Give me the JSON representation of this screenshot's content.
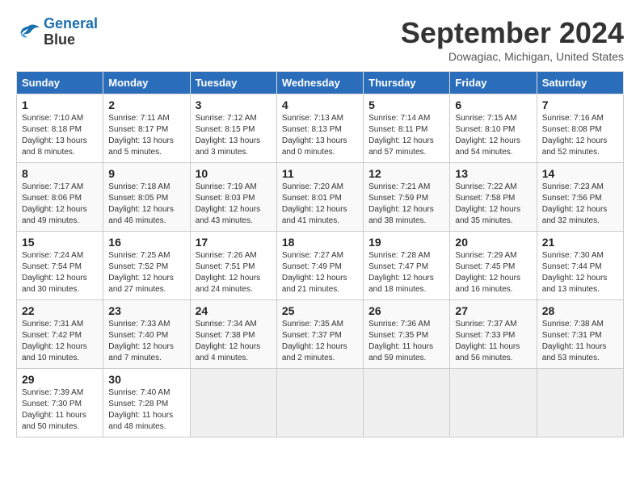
{
  "header": {
    "logo_line1": "General",
    "logo_line2": "Blue",
    "month": "September 2024",
    "location": "Dowagiac, Michigan, United States"
  },
  "days_of_week": [
    "Sunday",
    "Monday",
    "Tuesday",
    "Wednesday",
    "Thursday",
    "Friday",
    "Saturday"
  ],
  "weeks": [
    [
      {
        "day": "1",
        "info": "Sunrise: 7:10 AM\nSunset: 8:18 PM\nDaylight: 13 hours\nand 8 minutes."
      },
      {
        "day": "2",
        "info": "Sunrise: 7:11 AM\nSunset: 8:17 PM\nDaylight: 13 hours\nand 5 minutes."
      },
      {
        "day": "3",
        "info": "Sunrise: 7:12 AM\nSunset: 8:15 PM\nDaylight: 13 hours\nand 3 minutes."
      },
      {
        "day": "4",
        "info": "Sunrise: 7:13 AM\nSunset: 8:13 PM\nDaylight: 13 hours\nand 0 minutes."
      },
      {
        "day": "5",
        "info": "Sunrise: 7:14 AM\nSunset: 8:11 PM\nDaylight: 12 hours\nand 57 minutes."
      },
      {
        "day": "6",
        "info": "Sunrise: 7:15 AM\nSunset: 8:10 PM\nDaylight: 12 hours\nand 54 minutes."
      },
      {
        "day": "7",
        "info": "Sunrise: 7:16 AM\nSunset: 8:08 PM\nDaylight: 12 hours\nand 52 minutes."
      }
    ],
    [
      {
        "day": "8",
        "info": "Sunrise: 7:17 AM\nSunset: 8:06 PM\nDaylight: 12 hours\nand 49 minutes."
      },
      {
        "day": "9",
        "info": "Sunrise: 7:18 AM\nSunset: 8:05 PM\nDaylight: 12 hours\nand 46 minutes."
      },
      {
        "day": "10",
        "info": "Sunrise: 7:19 AM\nSunset: 8:03 PM\nDaylight: 12 hours\nand 43 minutes."
      },
      {
        "day": "11",
        "info": "Sunrise: 7:20 AM\nSunset: 8:01 PM\nDaylight: 12 hours\nand 41 minutes."
      },
      {
        "day": "12",
        "info": "Sunrise: 7:21 AM\nSunset: 7:59 PM\nDaylight: 12 hours\nand 38 minutes."
      },
      {
        "day": "13",
        "info": "Sunrise: 7:22 AM\nSunset: 7:58 PM\nDaylight: 12 hours\nand 35 minutes."
      },
      {
        "day": "14",
        "info": "Sunrise: 7:23 AM\nSunset: 7:56 PM\nDaylight: 12 hours\nand 32 minutes."
      }
    ],
    [
      {
        "day": "15",
        "info": "Sunrise: 7:24 AM\nSunset: 7:54 PM\nDaylight: 12 hours\nand 30 minutes."
      },
      {
        "day": "16",
        "info": "Sunrise: 7:25 AM\nSunset: 7:52 PM\nDaylight: 12 hours\nand 27 minutes."
      },
      {
        "day": "17",
        "info": "Sunrise: 7:26 AM\nSunset: 7:51 PM\nDaylight: 12 hours\nand 24 minutes."
      },
      {
        "day": "18",
        "info": "Sunrise: 7:27 AM\nSunset: 7:49 PM\nDaylight: 12 hours\nand 21 minutes."
      },
      {
        "day": "19",
        "info": "Sunrise: 7:28 AM\nSunset: 7:47 PM\nDaylight: 12 hours\nand 18 minutes."
      },
      {
        "day": "20",
        "info": "Sunrise: 7:29 AM\nSunset: 7:45 PM\nDaylight: 12 hours\nand 16 minutes."
      },
      {
        "day": "21",
        "info": "Sunrise: 7:30 AM\nSunset: 7:44 PM\nDaylight: 12 hours\nand 13 minutes."
      }
    ],
    [
      {
        "day": "22",
        "info": "Sunrise: 7:31 AM\nSunset: 7:42 PM\nDaylight: 12 hours\nand 10 minutes."
      },
      {
        "day": "23",
        "info": "Sunrise: 7:33 AM\nSunset: 7:40 PM\nDaylight: 12 hours\nand 7 minutes."
      },
      {
        "day": "24",
        "info": "Sunrise: 7:34 AM\nSunset: 7:38 PM\nDaylight: 12 hours\nand 4 minutes."
      },
      {
        "day": "25",
        "info": "Sunrise: 7:35 AM\nSunset: 7:37 PM\nDaylight: 12 hours\nand 2 minutes."
      },
      {
        "day": "26",
        "info": "Sunrise: 7:36 AM\nSunset: 7:35 PM\nDaylight: 11 hours\nand 59 minutes."
      },
      {
        "day": "27",
        "info": "Sunrise: 7:37 AM\nSunset: 7:33 PM\nDaylight: 11 hours\nand 56 minutes."
      },
      {
        "day": "28",
        "info": "Sunrise: 7:38 AM\nSunset: 7:31 PM\nDaylight: 11 hours\nand 53 minutes."
      }
    ],
    [
      {
        "day": "29",
        "info": "Sunrise: 7:39 AM\nSunset: 7:30 PM\nDaylight: 11 hours\nand 50 minutes."
      },
      {
        "day": "30",
        "info": "Sunrise: 7:40 AM\nSunset: 7:28 PM\nDaylight: 11 hours\nand 48 minutes."
      },
      {
        "day": "",
        "info": ""
      },
      {
        "day": "",
        "info": ""
      },
      {
        "day": "",
        "info": ""
      },
      {
        "day": "",
        "info": ""
      },
      {
        "day": "",
        "info": ""
      }
    ]
  ]
}
